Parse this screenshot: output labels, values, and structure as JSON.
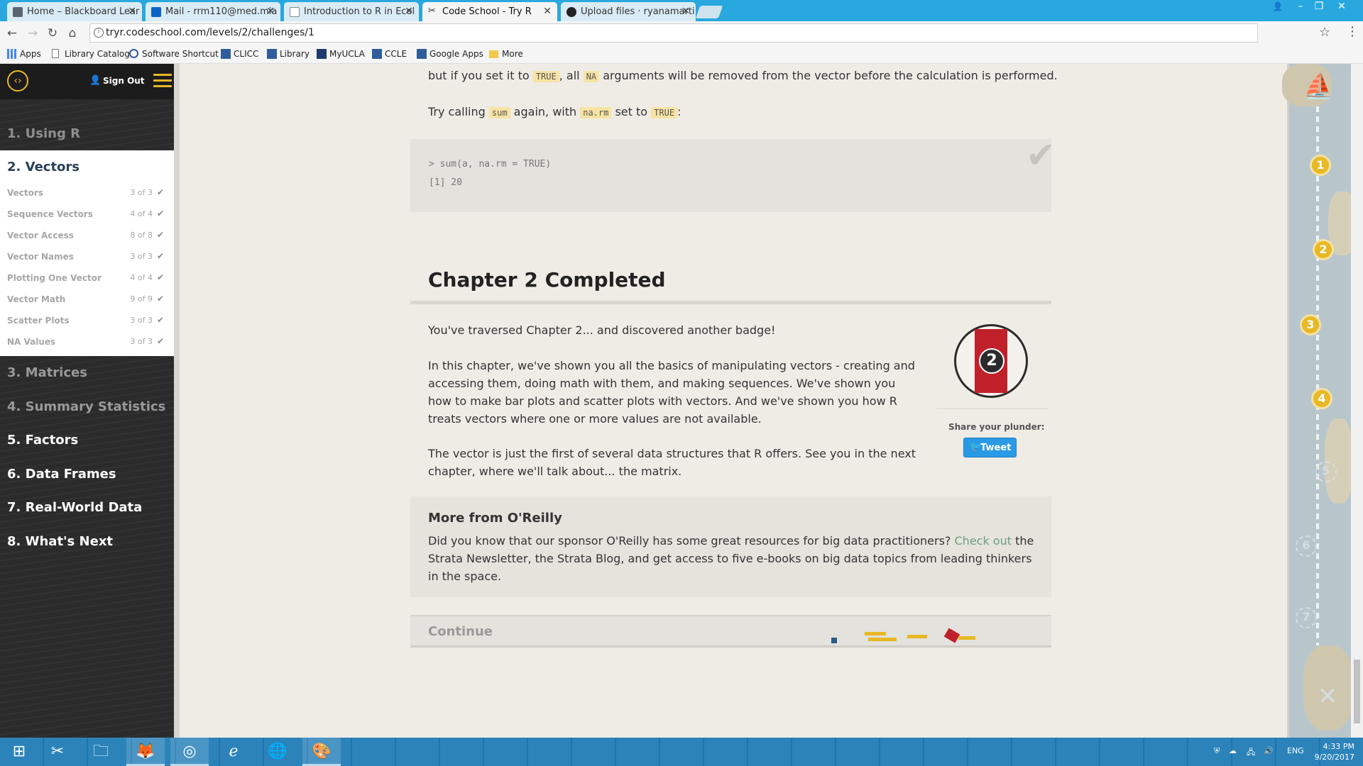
{
  "browser": {
    "tabs": [
      {
        "title": "Home – Blackboard Lear",
        "icon_color": "#5b6770"
      },
      {
        "title": "Mail - rrm110@med.mia",
        "icon_color": "#0a64c8"
      },
      {
        "title": "Introduction to R in Ecol",
        "icon_color": "#888888"
      },
      {
        "title": "Code School - Try R",
        "icon_color": "#333333"
      },
      {
        "title": "Upload files · ryanamarti",
        "icon_color": "#222222"
      }
    ],
    "url": "tryr.codeschool.com/levels/2/challenges/1",
    "bookmarks": [
      {
        "label": "Apps"
      },
      {
        "label": "Library Catalog"
      },
      {
        "label": "Software Shortcut"
      },
      {
        "label": "CLICC"
      },
      {
        "label": "Library"
      },
      {
        "label": "MyUCLA"
      },
      {
        "label": "CCLE"
      },
      {
        "label": "Google Apps"
      },
      {
        "label": "More"
      }
    ]
  },
  "sidebar": {
    "sign_out": "Sign Out",
    "chapters": [
      {
        "label": "1. Using R"
      },
      {
        "label": "2. Vectors"
      },
      {
        "label": "3. Matrices"
      },
      {
        "label": "4. Summary Statistics"
      },
      {
        "label": "5. Factors"
      },
      {
        "label": "6. Data Frames"
      },
      {
        "label": "7. Real-World Data"
      },
      {
        "label": "8. What's Next"
      }
    ],
    "lessons": [
      {
        "label": "Vectors",
        "count": "3 of 3"
      },
      {
        "label": "Sequence Vectors",
        "count": "4 of 4"
      },
      {
        "label": "Vector Access",
        "count": "8 of 8"
      },
      {
        "label": "Vector Names",
        "count": "3 of 3"
      },
      {
        "label": "Plotting One Vector",
        "count": "4 of 4"
      },
      {
        "label": "Vector Math",
        "count": "9 of 9"
      },
      {
        "label": "Scatter Plots",
        "count": "3 of 3"
      },
      {
        "label": "NA Values",
        "count": "3 of 3"
      }
    ]
  },
  "content": {
    "intro_line1_a": "but if you set it to",
    "code_true": "TRUE",
    "intro_line1_b": ", all",
    "code_na": "NA",
    "intro_line1_c": "arguments will be removed from the vector before the calculation is performed.",
    "intro_line2_a": "Try calling",
    "code_sum": "sum",
    "intro_line2_b": "again, with",
    "code_narm": "na.rm",
    "intro_line2_c": "set to",
    "intro_line2_d": ":",
    "console_input": "> sum(a, na.rm = TRUE)",
    "console_output": "[1] 20",
    "chapter_title": "Chapter 2 Completed",
    "para1": "You've traversed Chapter 2... and discovered another badge!",
    "para2": "In this chapter, we've shown you all the basics of manipulating vectors - creating and accessing them, doing math with them, and making sequences. We've shown you how to make bar plots and scatter plots with vectors. And we've shown you how R treats vectors where one or more values are not available.",
    "para3": "The vector is just the first of several data structures that R offers. See you in the next chapter, where we'll talk about... the matrix.",
    "badge_number": "2",
    "share_label": "Share your plunder:",
    "tweet_label": "Tweet",
    "oreilly_title": "More from O'Reilly",
    "oreilly_text_a": "Did you know that our sponsor O'Reilly has some great resources for big data practitioners?",
    "oreilly_link": "Check out",
    "oreilly_text_b": "the Strata Newsletter, the Strata Blog, and get access to five e-books on big data topics from leading thinkers in the space.",
    "continue_label": "Continue"
  },
  "map": {
    "markers": [
      "1",
      "2",
      "3",
      "4",
      "5",
      "6",
      "7"
    ],
    "completed": 4
  },
  "taskbar": {
    "language": "ENG",
    "time": "4:33 PM",
    "date": "9/20/2017"
  }
}
